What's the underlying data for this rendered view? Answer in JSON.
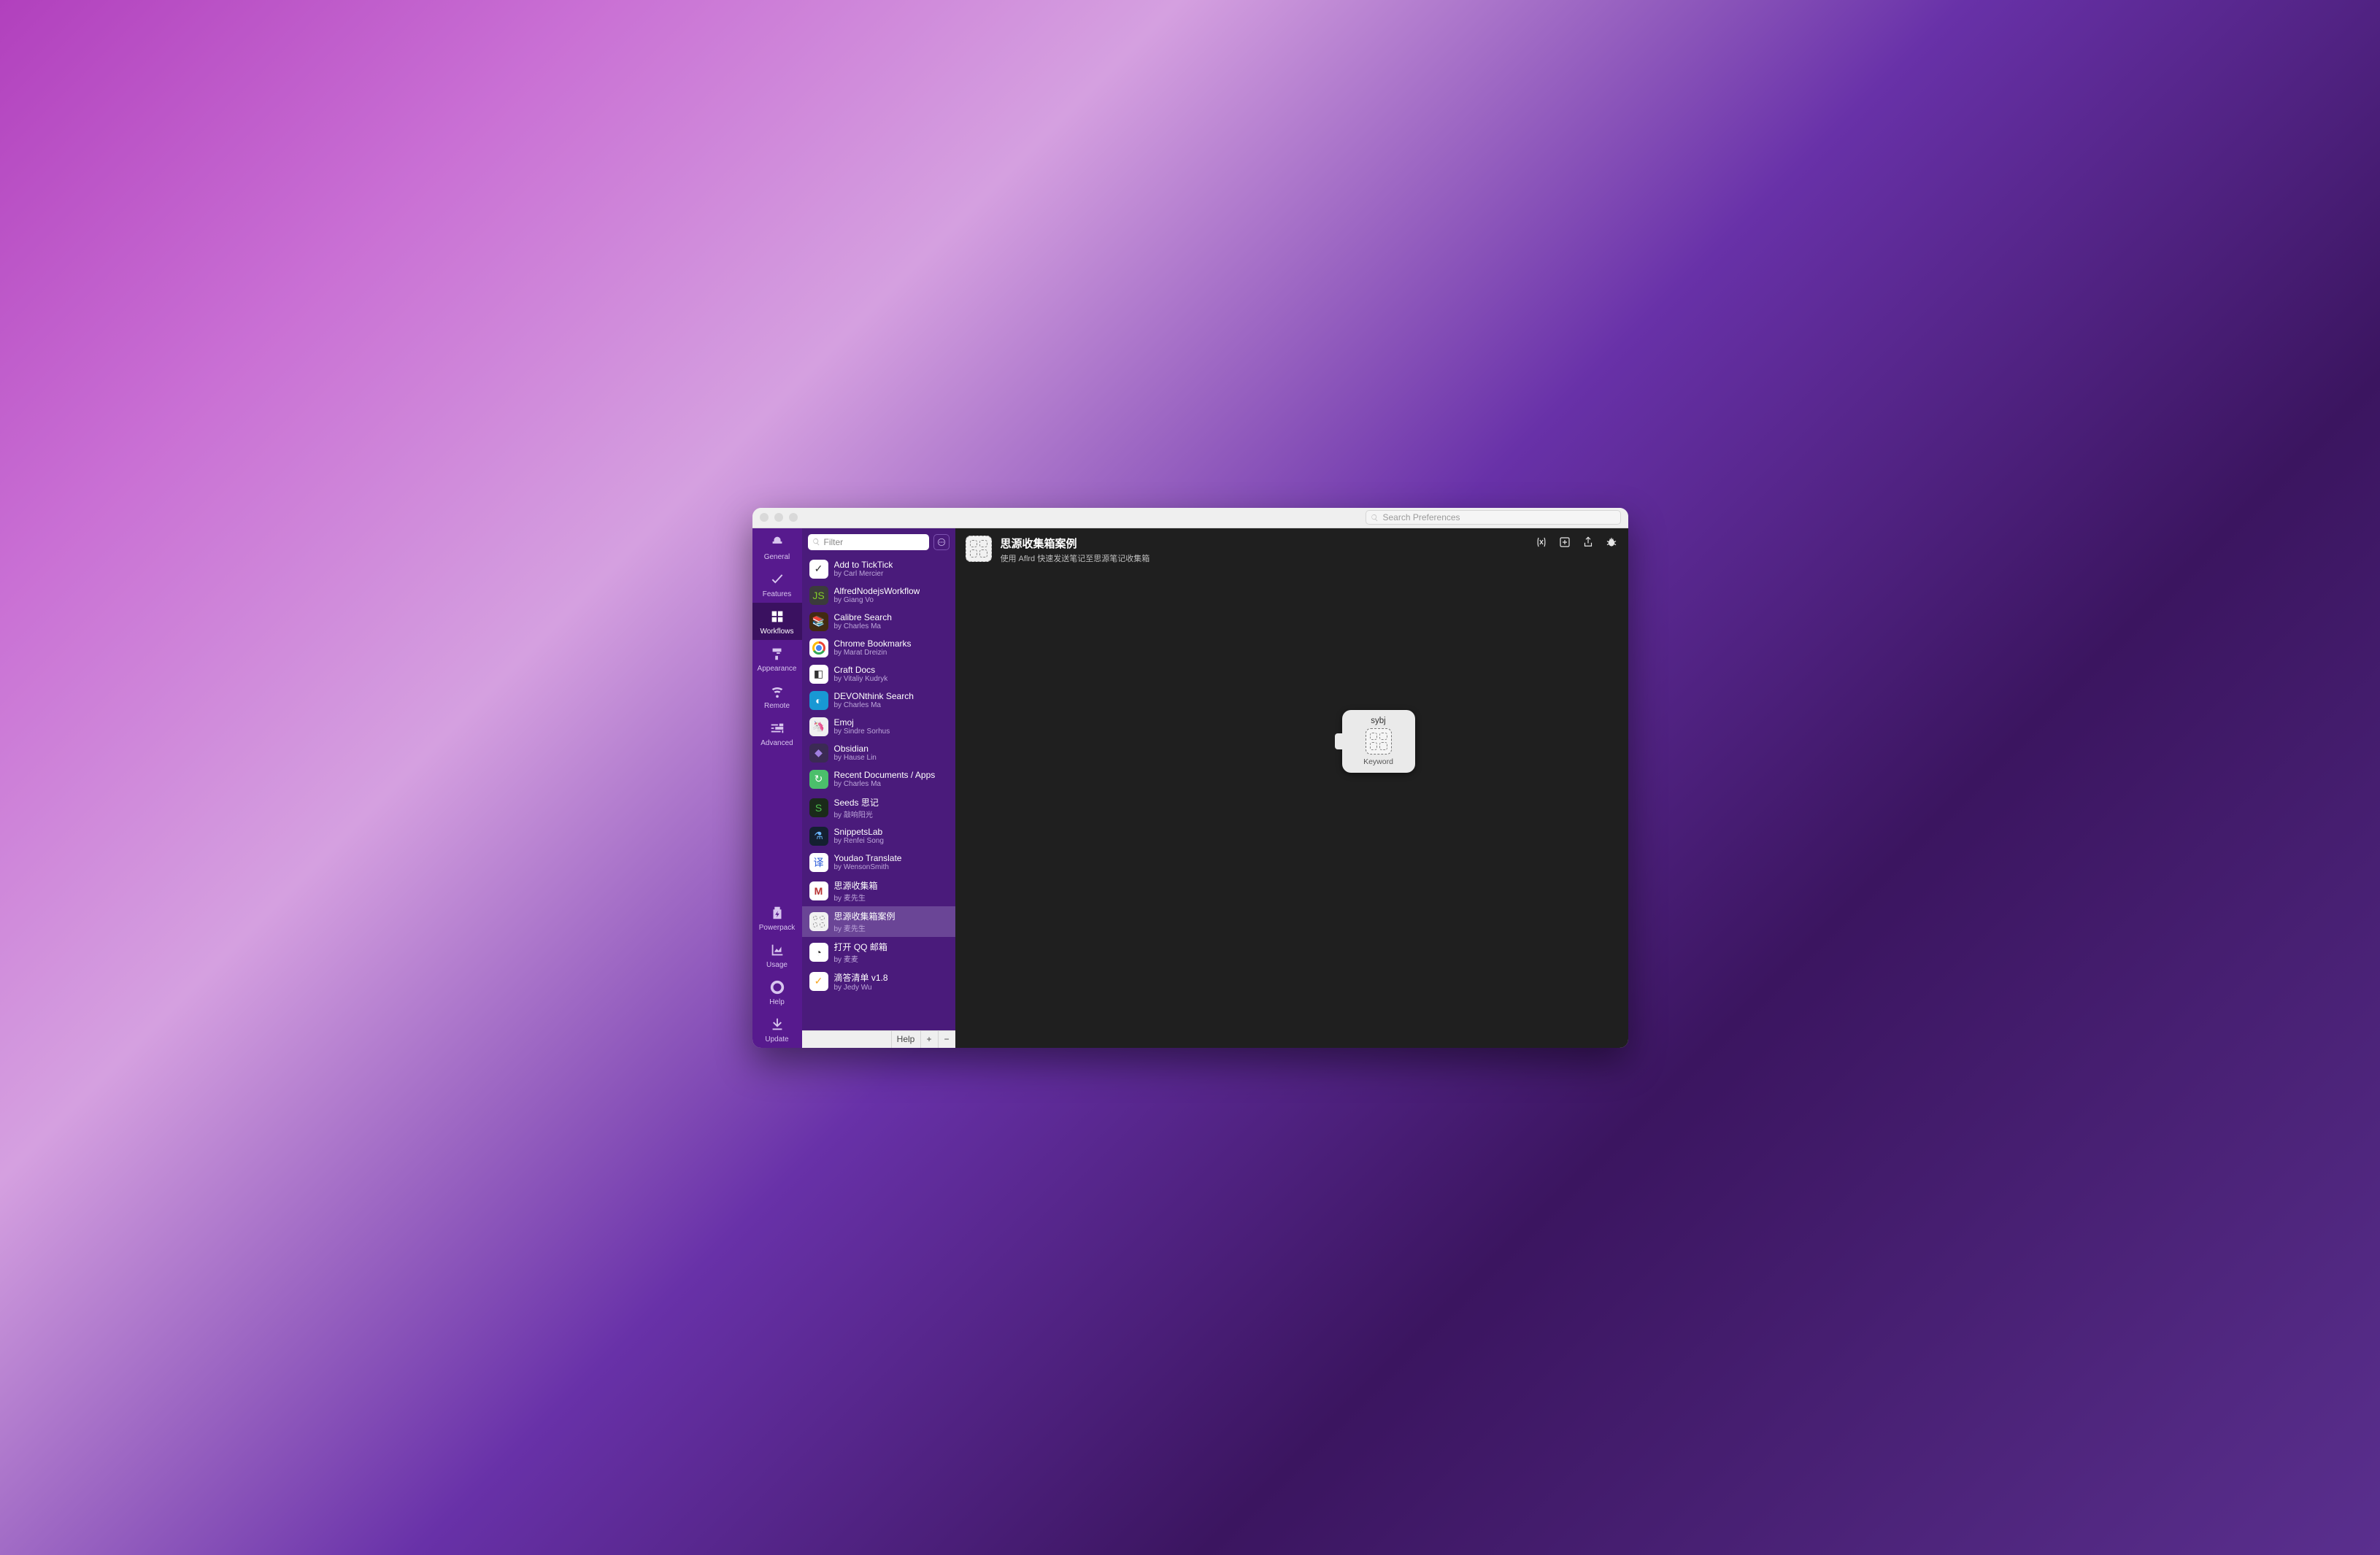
{
  "titlebar": {
    "search_placeholder": "Search Preferences"
  },
  "leftnav": {
    "top": [
      {
        "id": "general",
        "label": "General"
      },
      {
        "id": "features",
        "label": "Features"
      },
      {
        "id": "workflows",
        "label": "Workflows"
      },
      {
        "id": "appearance",
        "label": "Appearance"
      },
      {
        "id": "remote",
        "label": "Remote"
      },
      {
        "id": "advanced",
        "label": "Advanced"
      }
    ],
    "bottom": [
      {
        "id": "powerpack",
        "label": "Powerpack"
      },
      {
        "id": "usage",
        "label": "Usage"
      },
      {
        "id": "help",
        "label": "Help"
      },
      {
        "id": "update",
        "label": "Update"
      }
    ],
    "selected": "workflows"
  },
  "filter": {
    "placeholder": "Filter"
  },
  "workflows": [
    {
      "title": "Add to TickTick",
      "author": "by Carl Mercier",
      "icon": "ic-tick",
      "glyph": "✓"
    },
    {
      "title": "AlfredNodejsWorkflow",
      "author": "by Giang Vo",
      "icon": "ic-node",
      "glyph": "JS"
    },
    {
      "title": "Calibre Search",
      "author": "by Charles Ma",
      "icon": "ic-cal",
      "glyph": "📚"
    },
    {
      "title": "Chrome Bookmarks",
      "author": "by Marat Dreizin",
      "icon": "ic-chrome",
      "glyph": "chrome"
    },
    {
      "title": "Craft Docs",
      "author": "by Vitaliy Kudryk",
      "icon": "ic-craft",
      "glyph": "◧"
    },
    {
      "title": "DEVONthink Search",
      "author": "by Charles Ma",
      "icon": "ic-devon",
      "glyph": "◐"
    },
    {
      "title": "Emoj",
      "author": "by Sindre Sorhus",
      "icon": "ic-emoj",
      "glyph": "🦄"
    },
    {
      "title": "Obsidian",
      "author": "by Hause Lin",
      "icon": "ic-obs",
      "glyph": "◆"
    },
    {
      "title": "Recent Documents / Apps",
      "author": "by Charles Ma",
      "icon": "ic-recent",
      "glyph": "↻"
    },
    {
      "title": "Seeds 思记",
      "author": "by 敲响阳光",
      "icon": "ic-seeds",
      "glyph": "S"
    },
    {
      "title": "SnippetsLab",
      "author": "by Renfei Song",
      "icon": "ic-snip",
      "glyph": "⚗"
    },
    {
      "title": "Youdao Translate",
      "author": "by WensonSmith",
      "icon": "ic-youdao",
      "glyph": "译"
    },
    {
      "title": "思源收集箱",
      "author": "by 麦先生",
      "icon": "ic-sy1",
      "glyph": "M"
    },
    {
      "title": "思源收集箱案例",
      "author": "by 麦先生",
      "icon": "ic-placeholder",
      "glyph": "placeholder"
    },
    {
      "title": "打开 QQ 邮箱",
      "author": "by 麦麦",
      "icon": "ic-qq",
      "glyph": "◔"
    },
    {
      "title": "滴答清单 v1.8",
      "author": "by Jedy Wu",
      "icon": "ic-dida",
      "glyph": "✓"
    }
  ],
  "workflows_selected_index": 13,
  "list_footer": {
    "help": "Help",
    "add": "+",
    "remove": "−"
  },
  "canvas": {
    "title": "思源收集箱案例",
    "subtitle": "使用 Aflrd 快速发送笔记至思源笔记收集箱",
    "actions": {
      "variables_icon": "variables-icon",
      "add_icon": "add-box-icon",
      "share_icon": "share-icon",
      "debug_icon": "debug-icon"
    },
    "node": {
      "title": "sybj",
      "type": "Keyword"
    }
  }
}
